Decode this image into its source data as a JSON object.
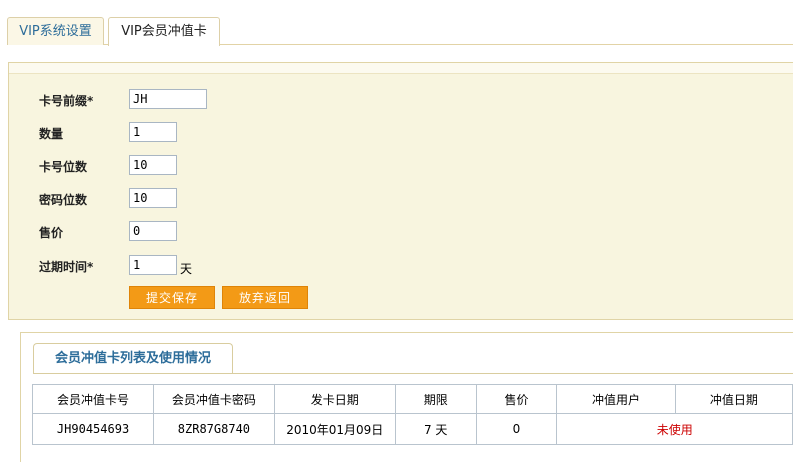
{
  "tabs": [
    {
      "label": "VIP系统设置",
      "active": false
    },
    {
      "label": "VIP会员冲值卡",
      "active": true
    }
  ],
  "form": {
    "prefix": {
      "label": "卡号前缀*",
      "value": "JH"
    },
    "quantity": {
      "label": "数量",
      "value": "1"
    },
    "card_digits": {
      "label": "卡号位数",
      "value": "10"
    },
    "password_digits": {
      "label": "密码位数",
      "value": "10"
    },
    "price": {
      "label": "售价",
      "value": "0"
    },
    "expire": {
      "label": "过期时间*",
      "value": "1",
      "unit": "天"
    },
    "submit_label": "提交保存",
    "cancel_label": "放弃返回"
  },
  "list": {
    "title": "会员冲值卡列表及使用情况",
    "columns": [
      "会员冲值卡号",
      "会员冲值卡密码",
      "发卡日期",
      "期限",
      "售价",
      "冲值用户",
      "冲值日期"
    ],
    "rows": [
      {
        "card_no": "JH90454693",
        "password": "8ZR87G8740",
        "issue_date": "2010年01月09日",
        "term": "7 天",
        "price": "0",
        "status": "未使用"
      }
    ]
  },
  "colors": {
    "accent": "#f39a16",
    "tab_text": "#2d6d9a",
    "panel_bg": "#f8f5df",
    "status_unused": "#cc0000"
  }
}
